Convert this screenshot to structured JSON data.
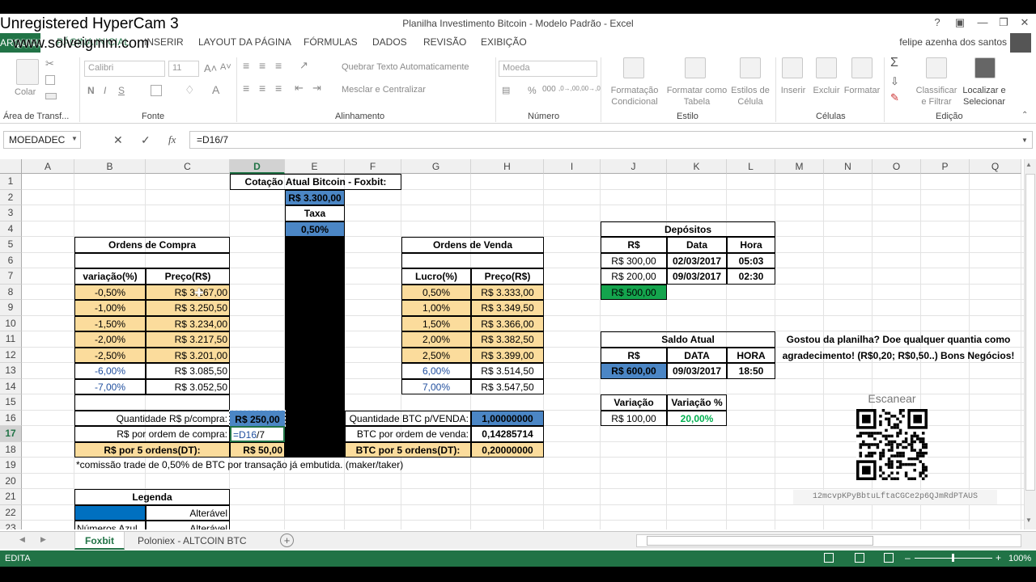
{
  "watermark": {
    "line1": "Unregistered HyperCam 3",
    "line2": "www.solveigmm.com"
  },
  "window": {
    "title": "Planilha Investimento Bitcoin - Modelo Padrão - Excel",
    "help": "?",
    "user": "felipe azenha dos santos"
  },
  "tabs": [
    "ARQUIVO",
    "PÁGINA INICIAL",
    "INSERIR",
    "LAYOUT DA PÁGINA",
    "FÓRMULAS",
    "DADOS",
    "REVISÃO",
    "EXIBIÇÃO"
  ],
  "ribbon": {
    "paste": "Colar",
    "clipboard": "Área de Transf...",
    "font_name": "Calibri",
    "font_size": "11",
    "font_group": "Fonte",
    "wrap_text": "Quebrar Texto Automaticamente",
    "merge_center": "Mesclar e Centralizar",
    "alignment_group": "Alinhamento",
    "number_format": "Moeda",
    "number_group": "Número",
    "cond_format": "Formatação Condicional",
    "format_table": "Formatar como Tabela",
    "cell_styles": "Estilos de Célula",
    "styles_group": "Estilo",
    "insert": "Inserir",
    "delete": "Excluir",
    "format": "Formatar",
    "cells_group": "Células",
    "sort_filter": "Classificar e Filtrar",
    "find_select": "Localizar e Selecionar",
    "editing_group": "Edição",
    "bold": "N",
    "italic": "I",
    "underline": "S",
    "percent": "%",
    "thousands": "000",
    "dec_inc": ",0→,00",
    "dec_dec": ",00→,0"
  },
  "formula_bar": {
    "name_box": "MOEDADEC",
    "formula": "=D16/7",
    "cancel": "✕",
    "enter": "✓",
    "fx": "fx"
  },
  "columns": [
    "A",
    "B",
    "C",
    "D",
    "E",
    "F",
    "G",
    "H",
    "I",
    "J",
    "K",
    "L",
    "M",
    "N",
    "O",
    "P",
    "Q"
  ],
  "rows": [
    "1",
    "2",
    "3",
    "4",
    "5",
    "6",
    "7",
    "8",
    "9",
    "10",
    "11",
    "12",
    "13",
    "14",
    "15",
    "16",
    "17",
    "18",
    "19",
    "20",
    "21",
    "22",
    "23"
  ],
  "cells": {
    "cotacao_title": "Cotação Atual Bitcoin - Foxbit:",
    "cotacao_value": "R$ 3.300,00",
    "taxa_label": "Taxa",
    "taxa_value": "0,50%",
    "ordens_compra": "Ordens de Compra",
    "ordens_venda": "Ordens de Venda",
    "variacao_hdr": "variação(%)",
    "preco_hdr": "Preço(R$)",
    "lucro_hdr": "Lucro(%)",
    "preco_venda_hdr": "Preço(R$)",
    "compra": [
      [
        "-0,50%",
        "R$ 3.267,00"
      ],
      [
        "-1,00%",
        "R$ 3.250,50"
      ],
      [
        "-1,50%",
        "R$ 3.234,00"
      ],
      [
        "-2,00%",
        "R$ 3.217,50"
      ],
      [
        "-2,50%",
        "R$ 3.201,00"
      ],
      [
        "-6,00%",
        "R$ 3.085,50"
      ],
      [
        "-7,00%",
        "R$ 3.052,50"
      ]
    ],
    "venda": [
      [
        "0,50%",
        "R$ 3.333,00"
      ],
      [
        "1,00%",
        "R$ 3.349,50"
      ],
      [
        "1,50%",
        "R$ 3.366,00"
      ],
      [
        "2,00%",
        "R$ 3.382,50"
      ],
      [
        "2,50%",
        "R$ 3.399,00"
      ],
      [
        "6,00%",
        "R$ 3.514,50"
      ],
      [
        "7,00%",
        "R$ 3.547,50"
      ]
    ],
    "qtd_compra_label": "Quantidade R$ p/compra:",
    "qtd_compra_value": "R$ 250,00",
    "por_ordem_label": "R$ por ordem de compra:",
    "edit_ref": "=D16",
    "edit_rest": "/7",
    "r5_label": "R$ por 5 ordens(DT):",
    "r5_value": "R$ 50,00",
    "qtd_btc_label": "Quantidade BTC p/VENDA:",
    "qtd_btc_value": "1,00000000",
    "btc_ordem_label": "BTC por ordem de venda:",
    "btc_ordem_value": "0,14285714",
    "btc5_label": "BTC por 5 ordens(DT):",
    "btc5_value": "0,20000000",
    "note": "*comissão trade de 0,50% de BTC por transação já embutida. (maker/taker)",
    "legenda": "Legenda",
    "alteravel": "Alterável",
    "alteravel2": "Alterável",
    "numeros_azul": "Números Azul",
    "depositos": "Depósitos",
    "dep_hdr": [
      "R$",
      "Data",
      "Hora"
    ],
    "dep_rows": [
      [
        "R$ 300,00",
        "02/03/2017",
        "05:03"
      ],
      [
        "R$ 200,00",
        "09/03/2017",
        "02:30"
      ]
    ],
    "dep_total": "R$ 500,00",
    "saldo_title": "Saldo Atual",
    "saldo_hdr": [
      "R$",
      "DATA",
      "HORA"
    ],
    "saldo_row": [
      "R$ 600,00",
      "09/03/2017",
      "18:50"
    ],
    "variacao_label": "Variação",
    "variacao_pct_label": "Variação %",
    "variacao_value": "R$ 100,00",
    "variacao_pct_value": "20,00%",
    "donation_1": "Gostou da planilha? Doe qualquer quantia como",
    "donation_2": "agradecimento! (R$0,20; R$0,50..) Bons Negócios!",
    "scan": "Escanear",
    "btc_address": "12mcvpKPyBbtuLftaCGCe2p6QJmRdPTAUS"
  },
  "sheets": [
    "Foxbit",
    "Poloniex - ALTCOIN BTC"
  ],
  "status": {
    "mode": "EDITA",
    "zoom": "100%"
  },
  "colors": {
    "excel_green": "#217346",
    "input_blue": "#4b86c5",
    "tan": "#fbdc9c",
    "deposit_green": "#14a44d",
    "pct_green": "#00b050"
  }
}
